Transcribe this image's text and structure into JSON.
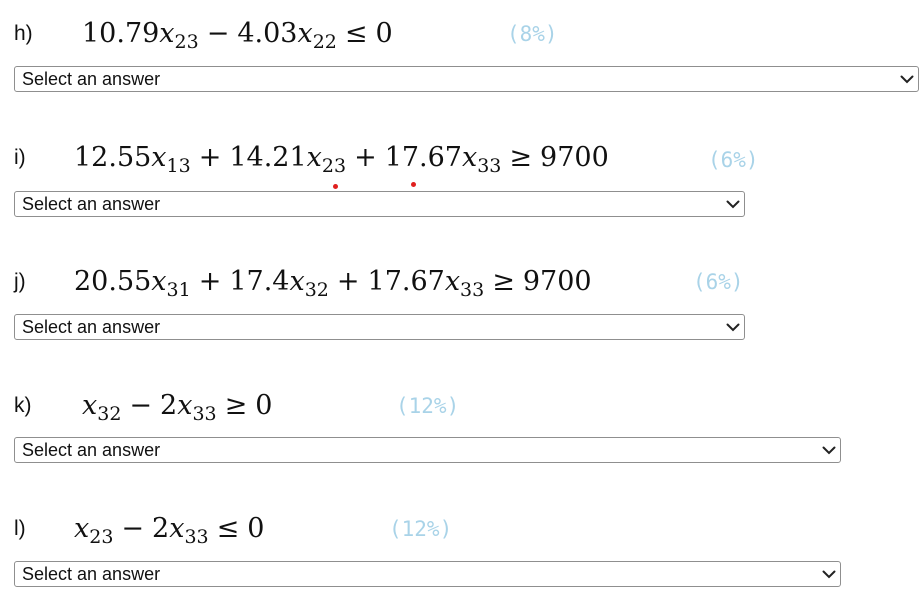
{
  "questions": [
    {
      "id": "h",
      "label": "h)",
      "pct": "(8%)",
      "select": "Select an answer",
      "terms": [
        {
          "coef": "10.79",
          "var": "x",
          "sub": "23"
        },
        {
          "op": "−"
        },
        {
          "coef": "4.03",
          "var": "x",
          "sub": "22"
        },
        {
          "op": "≤"
        },
        {
          "rhs": "0"
        }
      ]
    },
    {
      "id": "i",
      "label": "i)",
      "pct": "(6%)",
      "select": "Select an answer",
      "terms": [
        {
          "coef": "12.55",
          "var": "x",
          "sub": "13"
        },
        {
          "op": "+"
        },
        {
          "coef": "14.21",
          "var": "x",
          "sub": "23"
        },
        {
          "op": "+"
        },
        {
          "coef": "17.67",
          "var": "x",
          "sub": "33"
        },
        {
          "op": "≥"
        },
        {
          "rhs": "9700"
        }
      ]
    },
    {
      "id": "j",
      "label": "j)",
      "pct": "(6%)",
      "select": "Select an answer",
      "terms": [
        {
          "coef": "20.55",
          "var": "x",
          "sub": "31"
        },
        {
          "op": "+"
        },
        {
          "coef": "17.4",
          "var": "x",
          "sub": "32"
        },
        {
          "op": "+"
        },
        {
          "coef": "17.67",
          "var": "x",
          "sub": "33"
        },
        {
          "op": "≥"
        },
        {
          "rhs": "9700"
        }
      ]
    },
    {
      "id": "k",
      "label": "k)",
      "pct": "(12%)",
      "select": "Select an answer",
      "terms": [
        {
          "coef": "",
          "var": "x",
          "sub": "32"
        },
        {
          "op": "−"
        },
        {
          "coef": "2",
          "var": "x",
          "sub": "33"
        },
        {
          "op": "≥"
        },
        {
          "rhs": "0"
        }
      ]
    },
    {
      "id": "l",
      "label": "l)",
      "pct": "(12%)",
      "select": "Select an answer",
      "terms": [
        {
          "coef": "",
          "var": "x",
          "sub": "23"
        },
        {
          "op": "−"
        },
        {
          "coef": "2",
          "var": "x",
          "sub": "33"
        },
        {
          "op": "≤"
        },
        {
          "rhs": "0"
        }
      ]
    }
  ],
  "colors": {
    "percent": "#a9d3e8",
    "annotation_dot": "#e0201e",
    "select_border": "#8f8f8f"
  },
  "icons": {
    "dropdown": "chevron-down-icon"
  }
}
